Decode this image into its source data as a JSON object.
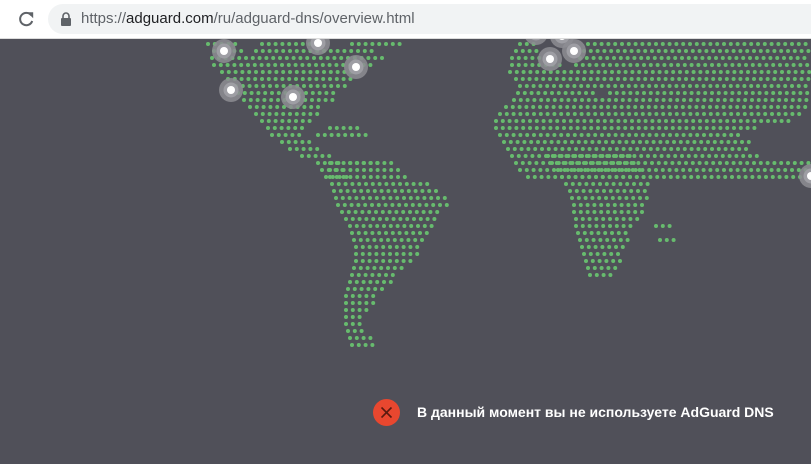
{
  "browser": {
    "url_prefix": "https://",
    "url_host": "adguard.com",
    "url_path": "/ru/adguard-dns/overview.html"
  },
  "colors": {
    "background": "#505059",
    "map_dot": "#67bb6e",
    "server_ring": "#8d8d93",
    "server_center": "#ffffff",
    "error": "#e8472f"
  },
  "icons": [
    "reload-icon",
    "lock-icon",
    "error-x-icon",
    "server-marker-icon"
  ],
  "status": {
    "message": "В данный момент вы не используете AdGuard DNS"
  }
}
